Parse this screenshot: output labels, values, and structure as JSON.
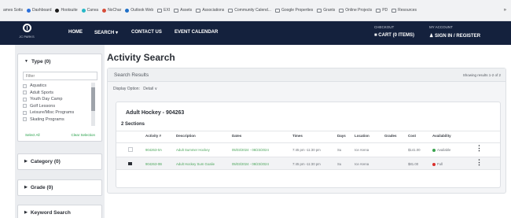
{
  "bookmarks": [
    {
      "label": "ames Sotts",
      "icon": "none"
    },
    {
      "label": "Dashboard",
      "icon": "dashboard-icon"
    },
    {
      "label": "Hootsuite",
      "icon": "hootsuite-icon"
    },
    {
      "label": "Canva",
      "icon": "canva-icon"
    },
    {
      "label": "NoChar",
      "icon": "nochar-icon"
    },
    {
      "label": "Outlook Web",
      "icon": "outlook-icon"
    },
    {
      "label": "EXI",
      "icon": "folder-icon"
    },
    {
      "label": "Assets",
      "icon": "folder-icon"
    },
    {
      "label": "Associations",
      "icon": "folder-icon"
    },
    {
      "label": "Community Calend...",
      "icon": "folder-icon"
    },
    {
      "label": "Google Properties",
      "icon": "folder-icon"
    },
    {
      "label": "Grants",
      "icon": "folder-icon"
    },
    {
      "label": "Online Projects",
      "icon": "folder-icon"
    },
    {
      "label": "PD",
      "icon": "folder-icon"
    },
    {
      "label": "Resources",
      "icon": "folder-icon"
    }
  ],
  "bookmarks_more": "»",
  "site": {
    "logo_text": "JC PARKS",
    "nav": [
      "HOME",
      "SEARCH ▾",
      "CONTACT US",
      "EVENT CALENDAR"
    ],
    "checkout_label": "CHECKOUT",
    "cart": "CART (0 ITEMS)",
    "account_label": "MY ACCOUNT",
    "sign_in": "SIGN IN / REGISTER"
  },
  "sidebar": {
    "type_title": "Type (0)",
    "filter_placeholder": "Filter",
    "type_items": [
      "Aquatics",
      "Adult Sports",
      "Youth Day Camp",
      "Golf Lessons",
      "Leisure/Misc Programs",
      "Skating Programs"
    ],
    "select_all": "Select All",
    "clear_selection": "Clear Selection",
    "category_title": "Category (0)",
    "grade_title": "Grade (0)",
    "keyword_title": "Keyword Search"
  },
  "main": {
    "title": "Activity Search",
    "results_label": "Search Results",
    "results_count": "Showing results 1-2 of 2",
    "display_option_label": "Display Option:",
    "display_option_value": "Detail ∨"
  },
  "card": {
    "title": "Adult Hockey - 904263",
    "sections": "2 Sections",
    "columns": [
      "Activity #",
      "Description",
      "Dates",
      "Times",
      "Days",
      "Location",
      "Grades",
      "Cost",
      "Availability"
    ],
    "rows": [
      {
        "activity": "904263-0A",
        "description": "Adult Summer Hockey",
        "dates": "05/03/2024 - 08/23/2024",
        "times": "7:45 pm -11:30 pm",
        "days": "Su",
        "location": "Ice Arena",
        "grades": "",
        "cost": "$141.00",
        "availability": "Available",
        "status_color": "#3aa34f",
        "checked": false
      },
      {
        "activity": "904263-0B",
        "description": "Adult Hockey Sum Goalie",
        "dates": "05/03/2024 - 08/23/2024",
        "times": "7:45 pm -11:30 pm",
        "days": "Su",
        "location": "Ice Arena",
        "grades": "",
        "cost": "$81.00",
        "availability": "Full",
        "status_color": "#d9302c",
        "checked": true
      }
    ]
  },
  "colors": {
    "nav_bg": "#14213d",
    "link_green": "#4aa55a",
    "available": "#3aa34f",
    "full": "#d9302c"
  }
}
